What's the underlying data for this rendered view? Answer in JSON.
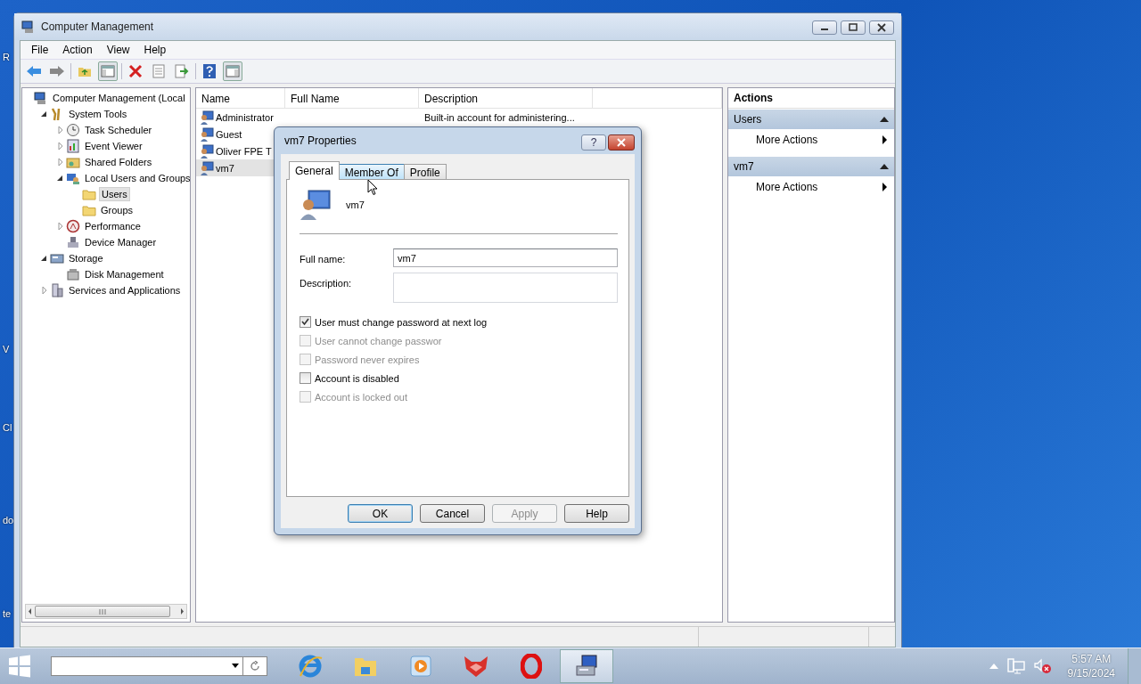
{
  "desktop_labels": [
    {
      "text": "R"
    },
    {
      "text": "V"
    },
    {
      "text": "Cl"
    },
    {
      "text": "do"
    },
    {
      "text": "te"
    }
  ],
  "window": {
    "title": "Computer Management"
  },
  "menu": [
    "File",
    "Action",
    "View",
    "Help"
  ],
  "tree": [
    {
      "label": "Computer Management (Local",
      "selected": false,
      "children": [
        {
          "label": "System Tools",
          "selected": false,
          "expanded": true,
          "children": [
            {
              "label": "Task Scheduler",
              "selected": false,
              "expanded": false
            },
            {
              "label": "Event Viewer",
              "selected": false,
              "expanded": false
            },
            {
              "label": "Shared Folders",
              "selected": false,
              "expanded": false
            },
            {
              "label": "Local Users and Groups",
              "selected": false,
              "expanded": true,
              "children": [
                {
                  "label": "Users",
                  "selected": true
                },
                {
                  "label": "Groups",
                  "selected": false
                }
              ]
            },
            {
              "label": "Performance",
              "selected": false,
              "expanded": false
            },
            {
              "label": "Device Manager",
              "selected": false
            }
          ]
        },
        {
          "label": "Storage",
          "selected": false,
          "expanded": true,
          "children": [
            {
              "label": "Disk Management",
              "selected": false
            }
          ]
        },
        {
          "label": "Services and Applications",
          "selected": false,
          "expanded": false
        }
      ]
    }
  ],
  "table": {
    "columns": [
      "Name",
      "Full Name",
      "Description"
    ],
    "rows": [
      {
        "name": "Administrator",
        "description": "Built-in account for administering...",
        "selected": false
      },
      {
        "name": "Guest",
        "selected": false
      },
      {
        "name": "Oliver FPE T",
        "selected": false
      },
      {
        "name": "vm7",
        "selected": true
      }
    ]
  },
  "actions": {
    "title": "Actions",
    "sections": [
      {
        "title": "Users",
        "items": [
          "More Actions"
        ]
      },
      {
        "title": "vm7",
        "items": [
          "More Actions"
        ]
      }
    ]
  },
  "dialog": {
    "title": "vm7 Properties",
    "help_glyph": "?",
    "tabs": [
      {
        "label": "General",
        "selected": true,
        "hovered": false
      },
      {
        "label": "Member Of",
        "selected": false,
        "hovered": true
      },
      {
        "label": "Profile",
        "selected": false,
        "hovered": false
      }
    ],
    "user_name": "vm7",
    "fields": [
      {
        "label": "Full name:",
        "value": "vm7",
        "kind": "line"
      },
      {
        "label": "Description:",
        "kind": "area"
      }
    ],
    "checkboxes": [
      {
        "label": "User must change password at next log",
        "checked": true,
        "disabled": false
      },
      {
        "label": "User cannot change passwor",
        "checked": false,
        "disabled": true
      },
      {
        "label": "Password never expires",
        "checked": false,
        "disabled": true
      },
      {
        "label": "Account is disabled",
        "checked": false,
        "disabled": false
      },
      {
        "label": "Account is locked out",
        "checked": false,
        "disabled": true
      }
    ],
    "buttons": [
      {
        "label": "OK",
        "default": true,
        "disabled": false
      },
      {
        "label": "Cancel",
        "default": false,
        "disabled": false
      },
      {
        "label": "Apply",
        "default": false,
        "disabled": true
      },
      {
        "label": "Help",
        "default": false,
        "disabled": false
      }
    ]
  },
  "taskbar": {
    "clock": {
      "time": "5:57 AM",
      "date": "9/15/2024"
    }
  }
}
